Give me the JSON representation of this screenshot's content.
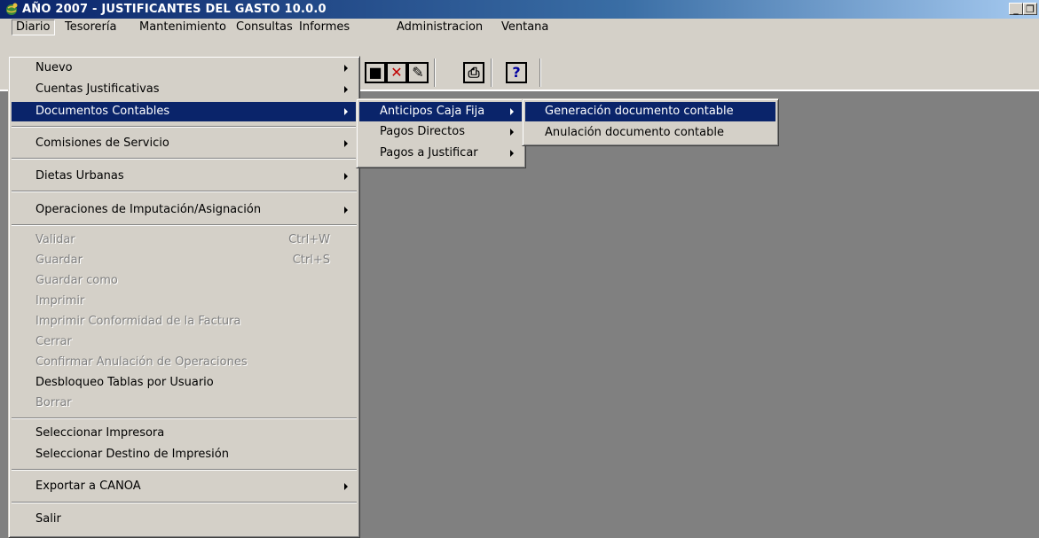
{
  "window": {
    "title": "AÑO 2007 - JUSTIFICANTES DEL GASTO 10.0.0",
    "icon": "app-globe-icon",
    "controls": [
      "_",
      "B",
      "X"
    ]
  },
  "menubar": {
    "items": [
      "Diario",
      "Tesorería",
      "Mantenimiento",
      "Consultas",
      "Informes",
      "Administracion",
      "Ventana"
    ],
    "active": "Diario"
  },
  "toolbar": {
    "buttons": [
      {
        "icon": "save-icon",
        "glyph": "■"
      },
      {
        "icon": "delete-icon",
        "glyph": "✕"
      },
      {
        "icon": "edit-icon",
        "glyph": "✎"
      },
      {
        "icon": "print-icon",
        "glyph": "⎙"
      },
      {
        "icon": "help-icon",
        "glyph": "?"
      }
    ]
  },
  "diario_menu": {
    "items": [
      {
        "label": "Nuevo",
        "submenu": true
      },
      {
        "label": "Cuentas Justificativas",
        "submenu": true
      },
      {
        "label": "Documentos Contables",
        "submenu": true,
        "highlighted": true
      },
      {
        "label": "Comisiones de Servicio",
        "submenu": true
      },
      {
        "label": "Dietas Urbanas",
        "submenu": true
      },
      {
        "label": "Operaciones de Imputación/Asignación",
        "submenu": true
      },
      {
        "label": "Validar",
        "shortcut": "Ctrl+W",
        "disabled": true
      },
      {
        "label": "Guardar",
        "shortcut": "Ctrl+S",
        "disabled": true
      },
      {
        "label": "Guardar como",
        "disabled": true
      },
      {
        "label": "Imprimir",
        "disabled": true
      },
      {
        "label": "Imprimir Conformidad de la Factura",
        "disabled": true
      },
      {
        "label": "Cerrar",
        "disabled": true
      },
      {
        "label": "Confirmar Anulación de Operaciones",
        "disabled": true
      },
      {
        "label": "Desbloqueo Tablas por Usuario"
      },
      {
        "label": "Borrar",
        "disabled": true
      },
      {
        "label": "Seleccionar Impresora"
      },
      {
        "label": "Seleccionar Destino de Impresión"
      },
      {
        "label": "Exportar a CANOA",
        "submenu": true
      },
      {
        "label": "Salir"
      }
    ]
  },
  "documentos_submenu": {
    "items": [
      {
        "label": "Anticipos Caja Fija",
        "submenu": true,
        "highlighted": true
      },
      {
        "label": "Pagos Directos",
        "submenu": true
      },
      {
        "label": "Pagos a Justificar",
        "submenu": true
      }
    ]
  },
  "anticipos_submenu": {
    "items": [
      {
        "label": "Generación documento contable",
        "highlighted": true
      },
      {
        "label": "Anulación documento contable"
      }
    ]
  },
  "colors": {
    "titlebar": "#0a246a",
    "highlight": "#0a246a",
    "face": "#d4d0c8",
    "workspace": "#808080"
  }
}
